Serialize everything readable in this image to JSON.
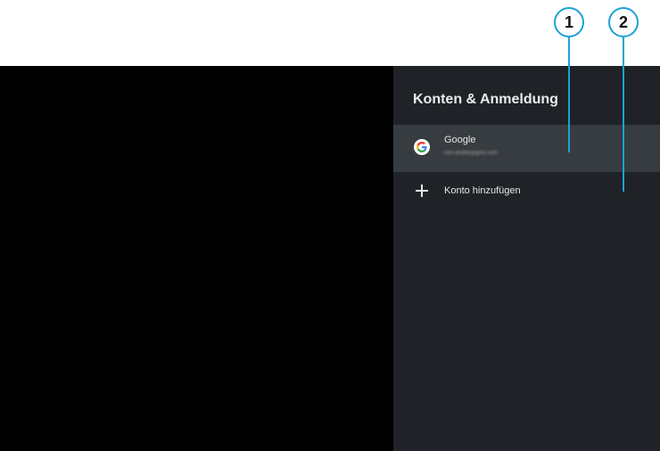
{
  "panel": {
    "title": "Konten & Anmeldung",
    "account": {
      "icon": "google-icon",
      "name": "Google",
      "email": "tom.landke@gmx.com"
    },
    "add_account": {
      "icon": "plus-icon",
      "label": "Konto hinzufügen"
    }
  },
  "callouts": {
    "first": "1",
    "second": "2"
  },
  "colors": {
    "panel_background": "#1f2327",
    "selected_row": "#373c40",
    "callout_accent": "#1aa3d6"
  }
}
